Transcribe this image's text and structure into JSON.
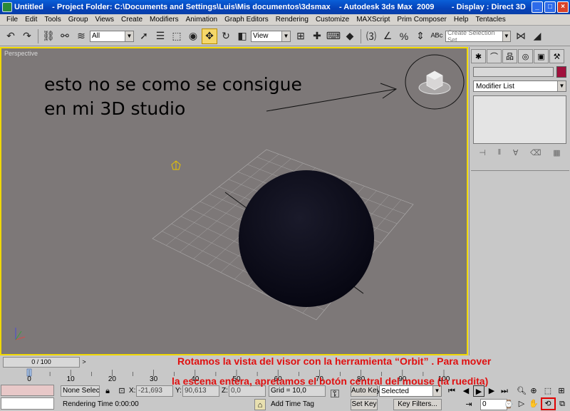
{
  "window": {
    "title": "Untitled    - Project Folder: C:\\Documents and Settings\\Luis\\Mis documentos\\3dsmax    - Autodesk 3ds Max  2009        - Display : Direct 3D",
    "minimize": "_",
    "maximize": "□",
    "close": "×"
  },
  "menu": [
    "File",
    "Edit",
    "Tools",
    "Group",
    "Views",
    "Create",
    "Modifiers",
    "Animation",
    "Graph Editors",
    "Rendering",
    "Customize",
    "MAXScript",
    "Prim Composer",
    "Help",
    "Tentacles"
  ],
  "toolbar": {
    "filter_select": "All",
    "reference_coord": "View",
    "named_selection_placeholder": "Create Selection Set"
  },
  "viewport": {
    "label": "Perspective",
    "annotation_line1": "esto no se como se consigue",
    "annotation_line2": "en mi 3D studio"
  },
  "command_panel": {
    "modifier_list": "Modifier List",
    "object_color": "#a0103c"
  },
  "timeline": {
    "frame_counter": "0 / 100",
    "prev_arrow": "<",
    "next_arrow": ">",
    "ruler_ticks": [
      "0",
      "10",
      "20",
      "30",
      "40",
      "50",
      "60",
      "70",
      "80",
      "90",
      "100"
    ]
  },
  "status": {
    "selection": "None Selecte",
    "x_label": "X:",
    "x_value": "-21,693",
    "y_label": "Y:",
    "y_value": "90,613",
    "z_label": "Z:",
    "z_value": "0,0",
    "grid": "Grid = 10,0",
    "rendering_time": "Rendering Time  0:00:00",
    "add_time_tag": "Add Time Tag",
    "auto_key": "Auto Key",
    "set_key": "Set Key",
    "key_mode": "Selected",
    "key_filters": "Key Filters...",
    "frame": "0"
  },
  "caption": {
    "line1": "Rotamos la vista del visor con la herramienta “Orbit” . Para mover",
    "line2": "la escena entera, apretamos el botón central del mouse (la ruedita)"
  }
}
